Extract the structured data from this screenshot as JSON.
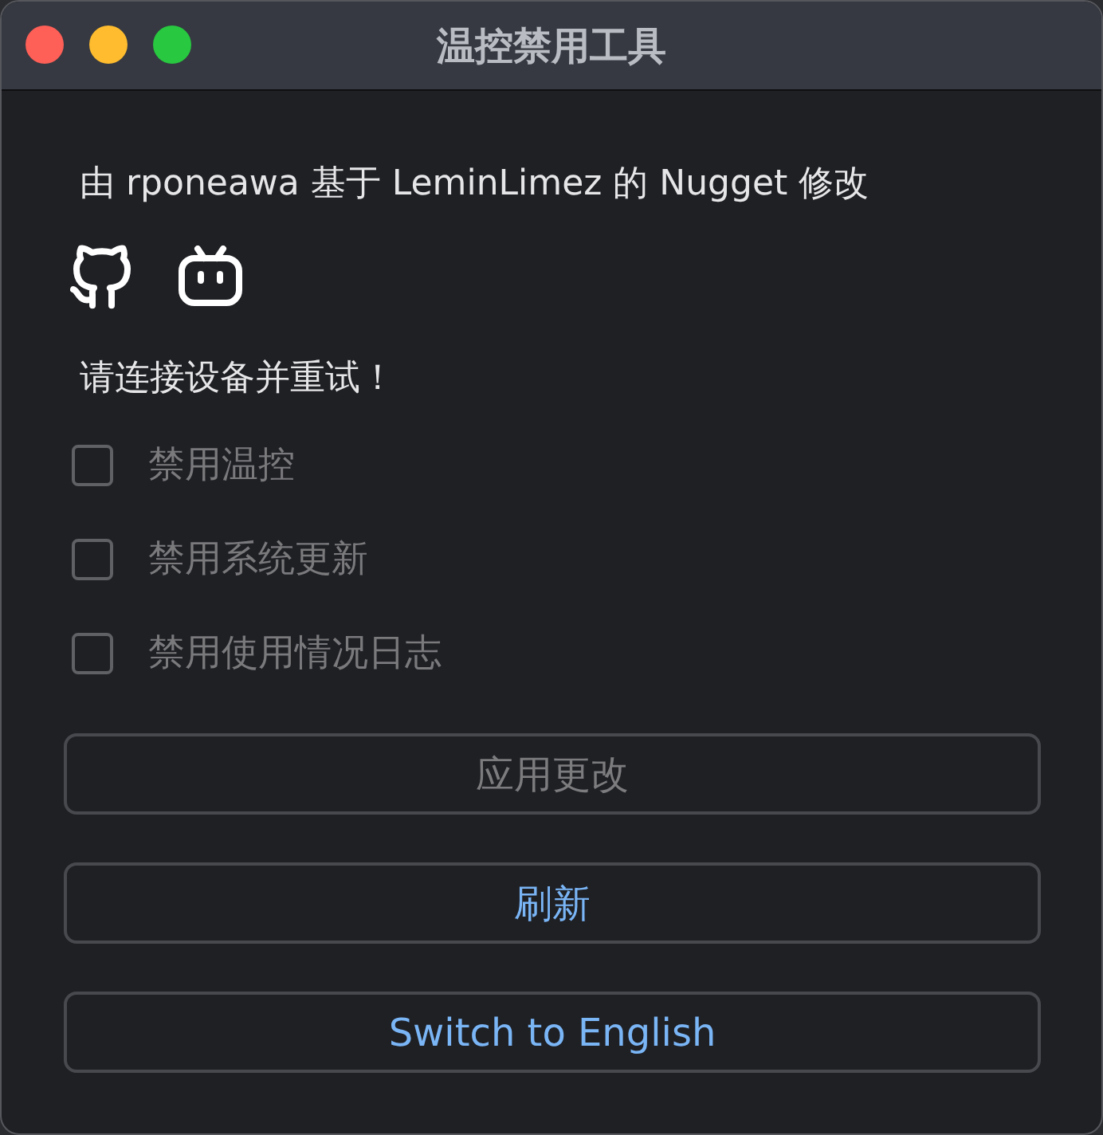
{
  "window": {
    "title": "温控禁用工具"
  },
  "credit": "由 rponeawa 基于 LeminLimez 的 Nugget 修改",
  "status": "请连接设备并重试！",
  "options": [
    {
      "label": "禁用温控",
      "checked": false,
      "disabled": true
    },
    {
      "label": "禁用系统更新",
      "checked": false,
      "disabled": true
    },
    {
      "label": "禁用使用情况日志",
      "checked": false,
      "disabled": true
    }
  ],
  "buttons": [
    {
      "label": "应用更改",
      "disabled": true
    },
    {
      "label": "刷新",
      "disabled": false
    },
    {
      "label": "Switch to English",
      "disabled": false
    }
  ]
}
